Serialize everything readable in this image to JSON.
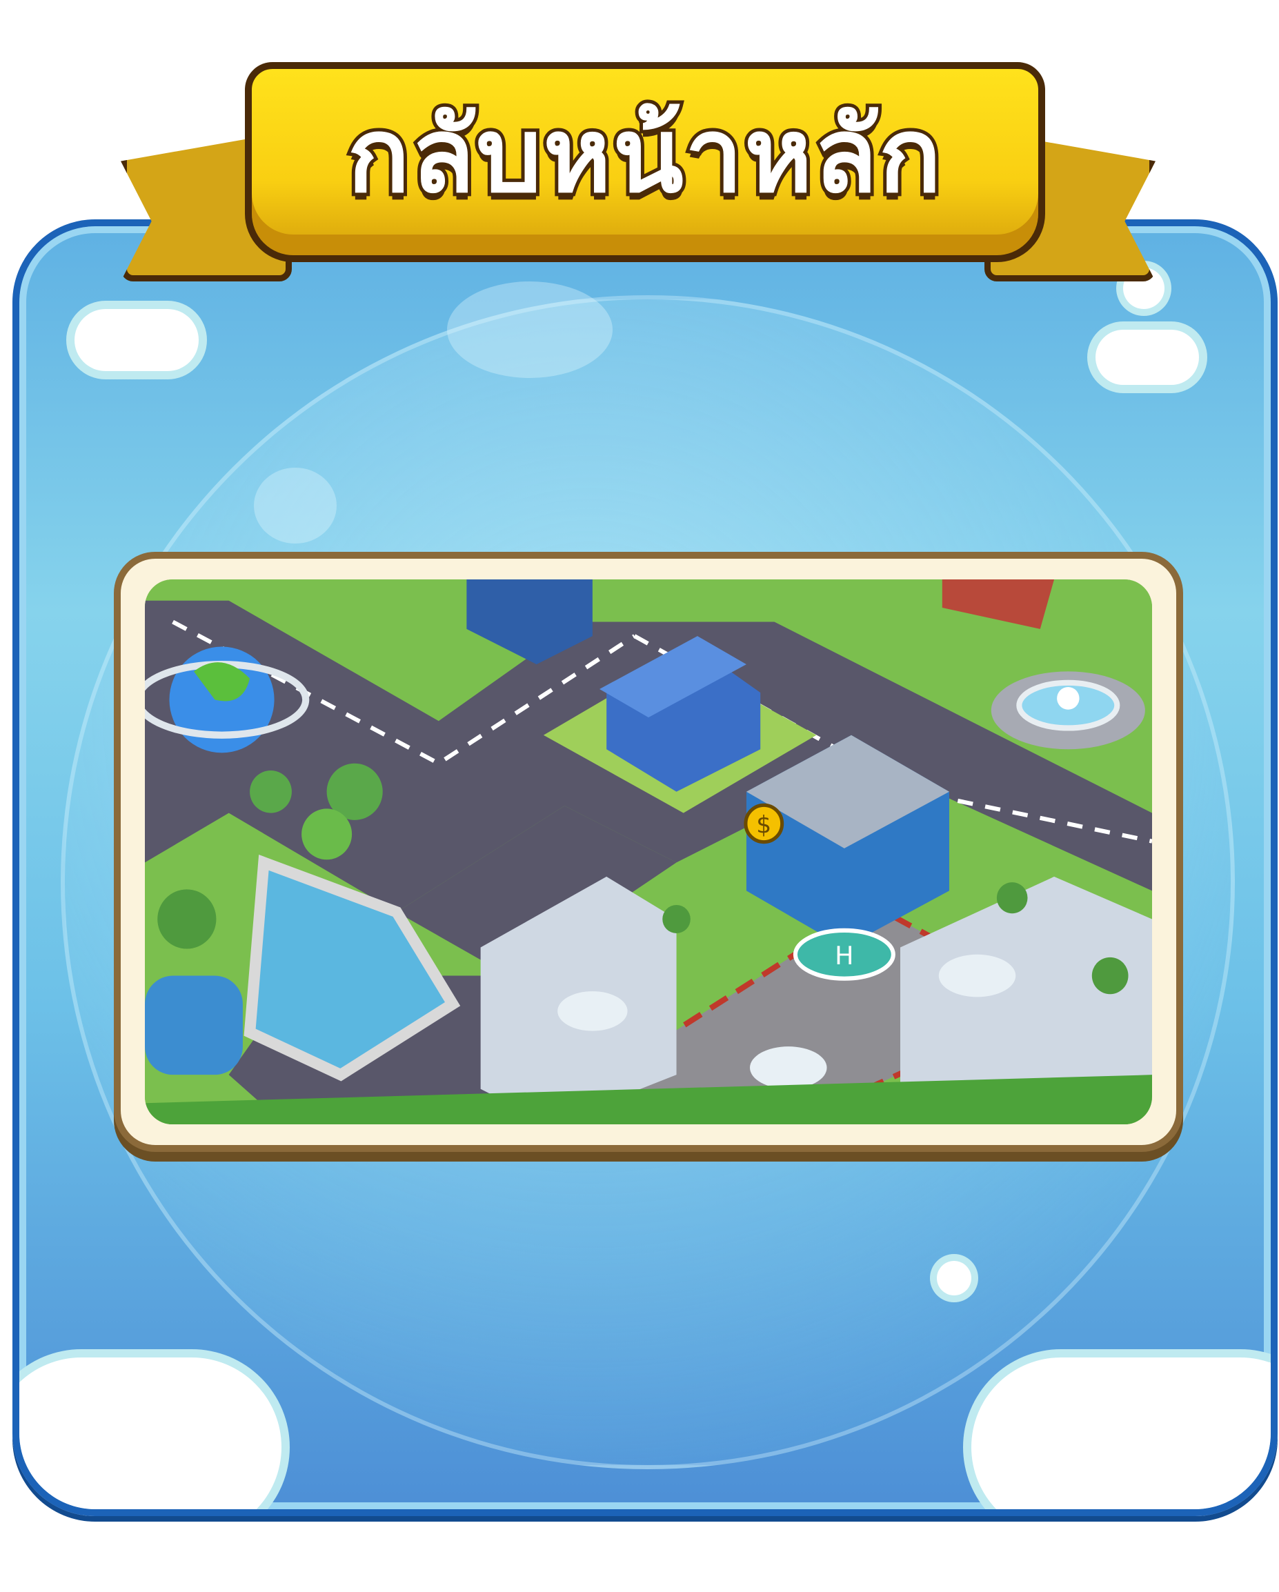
{
  "banner": {
    "title": "กลับหน้าหลัก"
  },
  "preview": {
    "icons": [
      "globe-icon",
      "dollar-icon",
      "helipad-icon",
      "fountain-icon",
      "clock-icon"
    ]
  },
  "colors": {
    "banner_fill": "#f9cf12",
    "banner_outline": "#4a2a08",
    "card_blue": "#1c63b8",
    "frame_cream": "#fbf3dc"
  }
}
